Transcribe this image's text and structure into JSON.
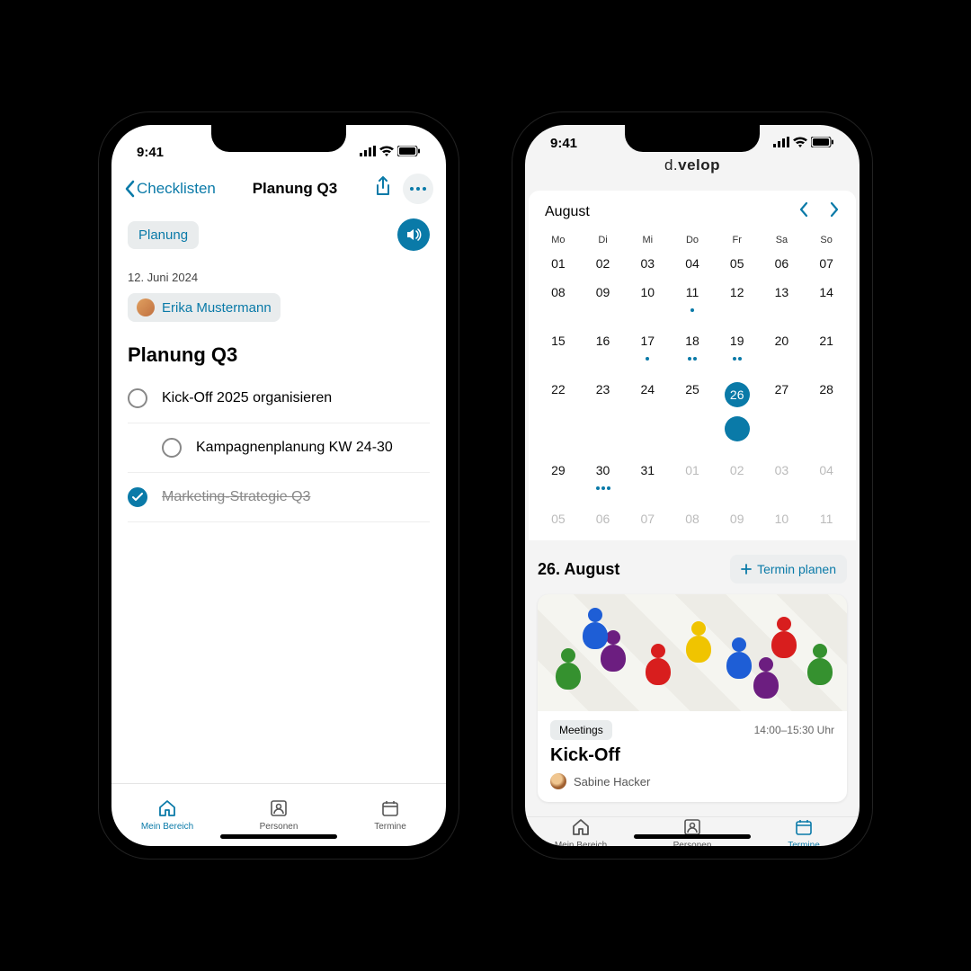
{
  "status": {
    "time": "9:41"
  },
  "phone1": {
    "nav": {
      "back": "Checklisten",
      "title": "Planung Q3"
    },
    "tag": "Planung",
    "date": "12. Juni 2024",
    "user": "Erika Mustermann",
    "list_title": "Planung Q3",
    "items": [
      {
        "label": "Kick-Off 2025 organisieren",
        "done": false,
        "indent": false
      },
      {
        "label": "Kampagnenplanung KW 24-30",
        "done": false,
        "indent": true
      },
      {
        "label": "Marketing-Strategie Q3",
        "done": true,
        "indent": false
      }
    ]
  },
  "tabs": {
    "home": "Mein Bereich",
    "people": "Personen",
    "dates": "Termine"
  },
  "phone2": {
    "brand": "d.velop",
    "month": "August",
    "weekdays": [
      "Mo",
      "Di",
      "Mi",
      "Do",
      "Fr",
      "Sa",
      "So"
    ],
    "weeks": [
      [
        {
          "n": "01"
        },
        {
          "n": "02"
        },
        {
          "n": "03"
        },
        {
          "n": "04"
        },
        {
          "n": "05"
        },
        {
          "n": "06"
        },
        {
          "n": "07"
        }
      ],
      [
        {
          "n": "08"
        },
        {
          "n": "09"
        },
        {
          "n": "10"
        },
        {
          "n": "11",
          "d": 1
        },
        {
          "n": "12"
        },
        {
          "n": "13"
        },
        {
          "n": "14"
        }
      ],
      [
        {
          "n": "15"
        },
        {
          "n": "16"
        },
        {
          "n": "17",
          "d": 1
        },
        {
          "n": "18",
          "d": 2
        },
        {
          "n": "19",
          "d": 2
        },
        {
          "n": "20"
        },
        {
          "n": "21"
        }
      ],
      [
        {
          "n": "22"
        },
        {
          "n": "23"
        },
        {
          "n": "24"
        },
        {
          "n": "25"
        },
        {
          "n": "26",
          "sel": true,
          "d": 1
        },
        {
          "n": "27"
        },
        {
          "n": "28"
        }
      ],
      [
        {
          "n": "29"
        },
        {
          "n": "30",
          "d": 3
        },
        {
          "n": "31"
        },
        {
          "n": "01",
          "m": true
        },
        {
          "n": "02",
          "m": true
        },
        {
          "n": "03",
          "m": true
        },
        {
          "n": "04",
          "m": true
        }
      ],
      [
        {
          "n": "05",
          "m": true
        },
        {
          "n": "06",
          "m": true
        },
        {
          "n": "07",
          "m": true
        },
        {
          "n": "08",
          "m": true
        },
        {
          "n": "09",
          "m": true
        },
        {
          "n": "10",
          "m": true
        },
        {
          "n": "11",
          "m": true
        }
      ]
    ],
    "day_title": "26. August",
    "plan_button": "Termin planen",
    "event": {
      "category": "Meetings",
      "time": "14:00–15:30 Uhr",
      "title": "Kick-Off",
      "attendee": "Sabine Hacker"
    }
  }
}
